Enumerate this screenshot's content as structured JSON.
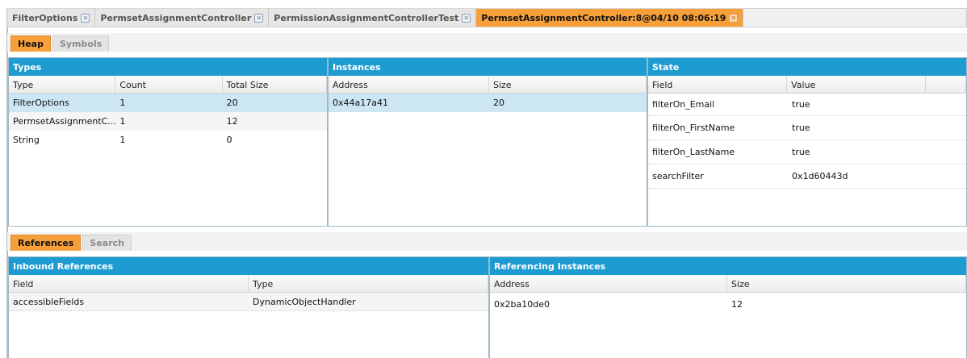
{
  "editor_tabs": [
    {
      "label": "FilterOptions",
      "active": false
    },
    {
      "label": "PermsetAssignmentController",
      "active": false
    },
    {
      "label": "PermissionAssignmentControllerTest",
      "active": false
    },
    {
      "label": "PermsetAssignmentController:8@04/10 08:06:19",
      "active": true
    }
  ],
  "top_subtabs": {
    "heap": "Heap",
    "symbols": "Symbols"
  },
  "types": {
    "title": "Types",
    "headers": [
      "Type",
      "Count",
      "Total Size"
    ],
    "rows": [
      [
        "FilterOptions",
        "1",
        "20"
      ],
      [
        "PermsetAssignmentC...",
        "1",
        "12"
      ],
      [
        "String",
        "1",
        "0"
      ]
    ]
  },
  "instances": {
    "title": "Instances",
    "headers": [
      "Address",
      "Size"
    ],
    "rows": [
      [
        "0x44a17a41",
        "20"
      ]
    ]
  },
  "state": {
    "title": "State",
    "headers": [
      "Field",
      "Value"
    ],
    "rows": [
      [
        "filterOn_Email",
        "true"
      ],
      [
        "filterOn_FirstName",
        "true"
      ],
      [
        "filterOn_LastName",
        "true"
      ],
      [
        "searchFilter",
        "0x1d60443d"
      ]
    ]
  },
  "bottom_subtabs": {
    "references": "References",
    "search": "Search"
  },
  "inbound": {
    "title": "Inbound References",
    "headers": [
      "Field",
      "Type"
    ],
    "rows": [
      [
        "accessibleFields",
        "DynamicObjectHandler"
      ]
    ]
  },
  "referencing": {
    "title": "Referencing Instances",
    "headers": [
      "Address",
      "Size"
    ],
    "rows": [
      [
        "0x2ba10de0",
        "12"
      ]
    ]
  },
  "colors": {
    "accent_tab": "#f7a03a",
    "panel_title": "#1e9cd1",
    "selected_row": "#cde6f4"
  }
}
